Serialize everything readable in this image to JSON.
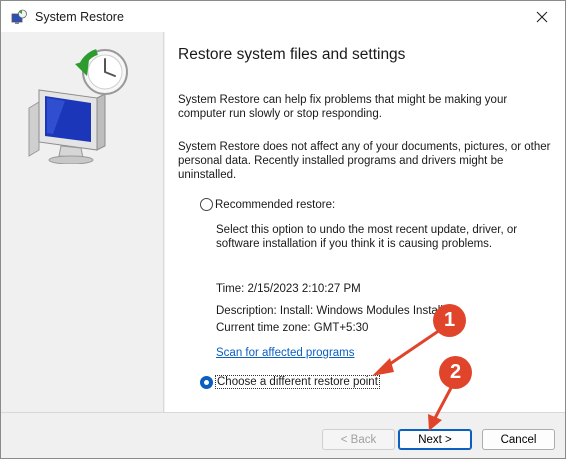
{
  "window": {
    "title": "System Restore"
  },
  "icons": {
    "app": "system-restore-icon",
    "close": "close-icon"
  },
  "content": {
    "heading": "Restore system files and settings",
    "para1": "System Restore can help fix problems that might be making your computer run slowly or stop responding.",
    "para2": "System Restore does not affect any of your documents, pictures, or other personal data. Recently installed programs and drivers might be uninstalled.",
    "recommended": {
      "label": "Recommended restore:",
      "checked": false,
      "description": "Select this option to undo the most recent update, driver, or software installation if you think it is causing problems.",
      "time": "Time: 2/15/2023 2:10:27 PM",
      "desc_line": "Description: Install: Windows Modules Installer",
      "timezone": "Current time zone: GMT+5:30",
      "scan_link": "Scan for affected programs"
    },
    "different": {
      "label": "Choose a different restore point",
      "checked": true
    }
  },
  "buttons": {
    "back": "< Back",
    "next": "Next >",
    "cancel": "Cancel"
  },
  "annotations": {
    "callout1": "1",
    "callout2": "2",
    "color": "#e0452b"
  }
}
